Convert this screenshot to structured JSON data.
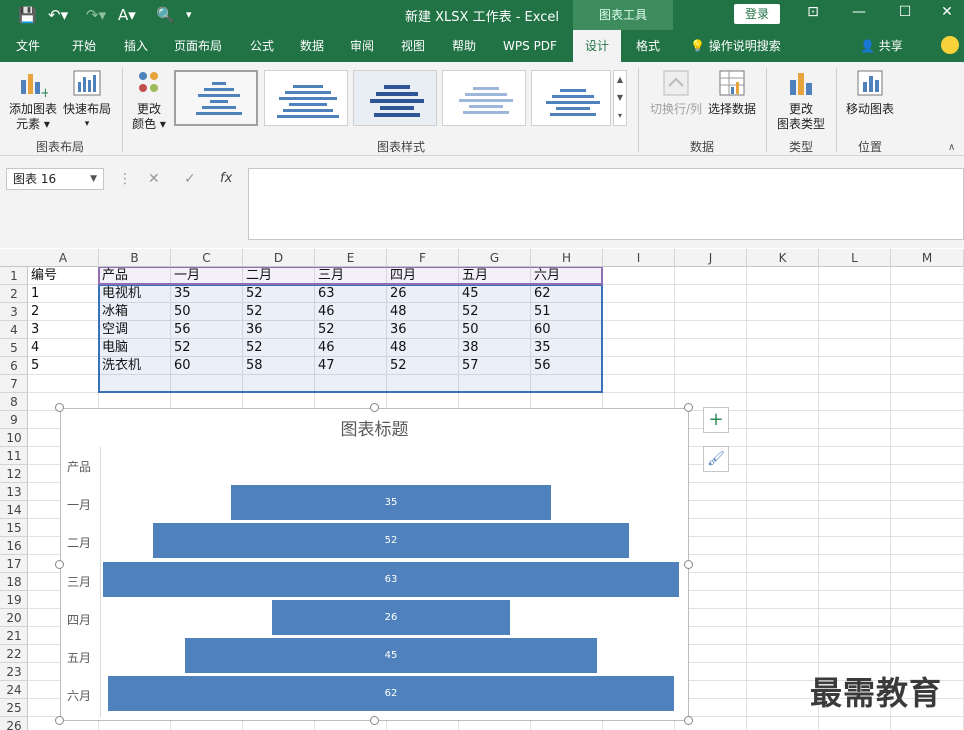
{
  "titlebar": {
    "doc_title": "新建 XLSX 工作表  -  Excel",
    "context_tab": "图表工具",
    "login": "登录"
  },
  "tabs": [
    "文件",
    "开始",
    "插入",
    "页面布局",
    "公式",
    "数据",
    "审阅",
    "视图",
    "帮助",
    "WPS PDF",
    "设计",
    "格式"
  ],
  "active_tab": "设计",
  "search": "操作说明搜索",
  "share": "共享",
  "ribbon": {
    "add_element_1": "添加图表",
    "add_element_2": "元素",
    "quick_layout": "快速布局",
    "change_color_1": "更改",
    "change_color_2": "颜色",
    "group_layout": "图表布局",
    "group_styles": "图表样式",
    "switch_rowcol": "切换行/列",
    "select_data": "选择数据",
    "group_data": "数据",
    "change_type_1": "更改",
    "change_type_2": "图表类型",
    "group_type": "类型",
    "move_chart": "移动图表",
    "group_location": "位置"
  },
  "formula_bar": {
    "name_box": "图表 16",
    "fx": "fx"
  },
  "columns": [
    "A",
    "B",
    "C",
    "D",
    "E",
    "F",
    "G",
    "H",
    "I",
    "J",
    "K",
    "L",
    "M"
  ],
  "rows": [
    "1",
    "2",
    "3",
    "4",
    "5",
    "6",
    "7",
    "8",
    "9",
    "10",
    "11",
    "12",
    "13",
    "14",
    "15",
    "16",
    "17",
    "18",
    "19",
    "20",
    "21",
    "22",
    "23",
    "24",
    "25",
    "26"
  ],
  "sheet": {
    "header": [
      "编号",
      "产品",
      "一月",
      "二月",
      "三月",
      "四月",
      "五月",
      "六月"
    ],
    "data": [
      [
        "1",
        "电视机",
        "35",
        "52",
        "63",
        "26",
        "45",
        "62"
      ],
      [
        "2",
        "冰箱",
        "50",
        "52",
        "46",
        "48",
        "52",
        "51"
      ],
      [
        "3",
        "空调",
        "56",
        "36",
        "52",
        "36",
        "50",
        "60"
      ],
      [
        "4",
        "电脑",
        "52",
        "52",
        "46",
        "48",
        "38",
        "35"
      ],
      [
        "5",
        "洗衣机",
        "60",
        "58",
        "47",
        "52",
        "57",
        "56"
      ]
    ]
  },
  "chart_data": {
    "type": "bar",
    "orientation": "horizontal",
    "title": "图表标题",
    "categories": [
      "产品",
      "一月",
      "二月",
      "三月",
      "四月",
      "五月",
      "六月"
    ],
    "values": [
      null,
      35,
      52,
      63,
      26,
      45,
      62
    ],
    "data_labels": [
      "",
      "35",
      "52",
      "63",
      "26",
      "45",
      "62"
    ],
    "max": 63,
    "color": "#4f81bd"
  },
  "watermark": "最需教育"
}
